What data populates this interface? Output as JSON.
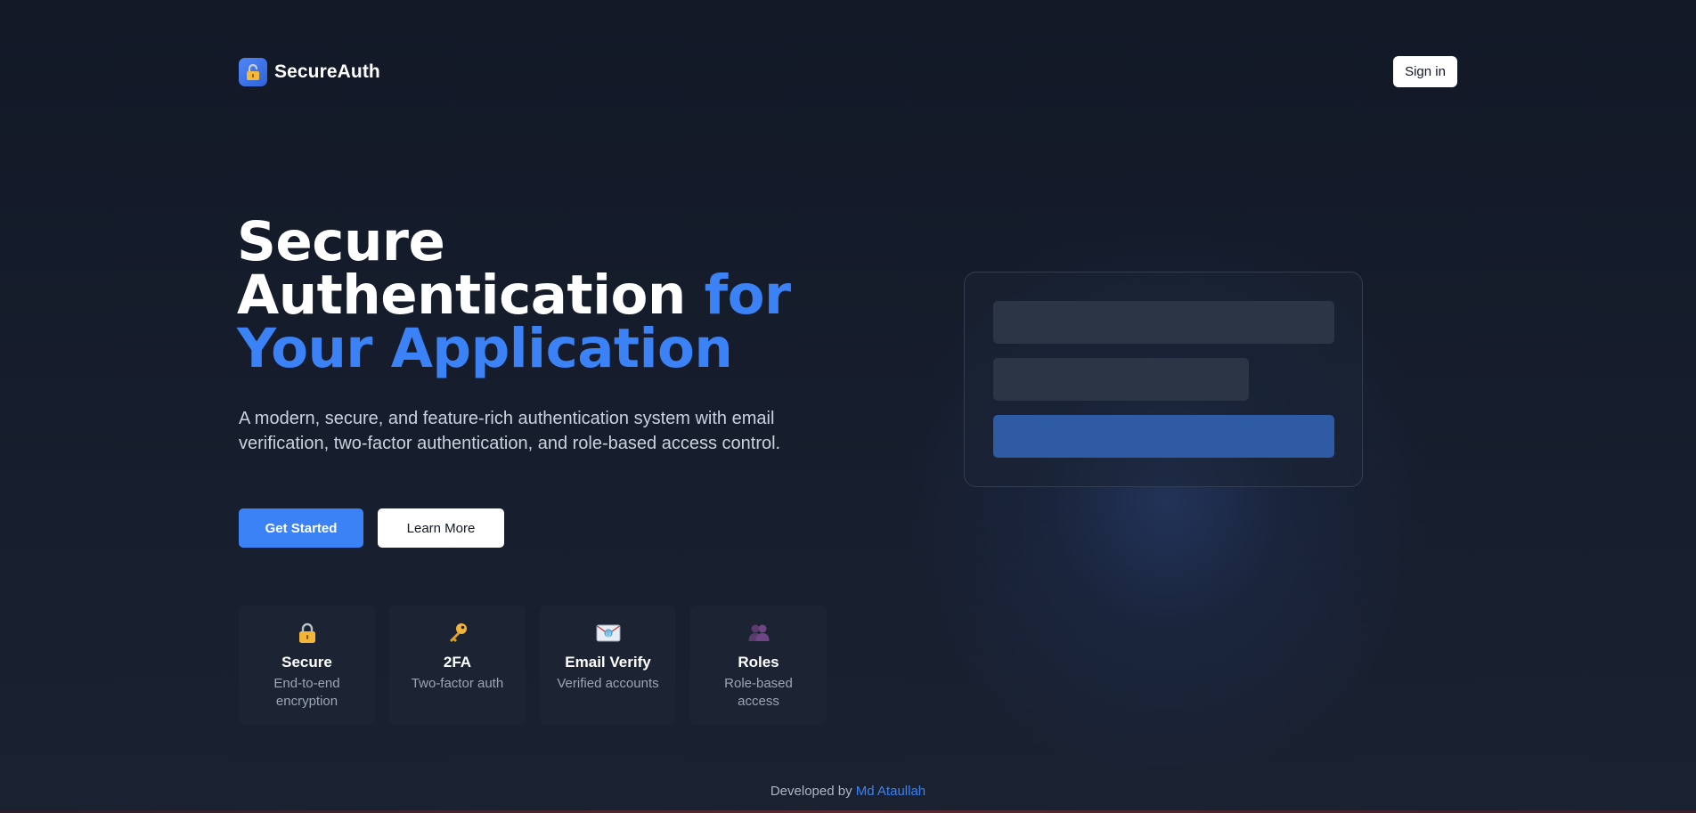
{
  "header": {
    "brand_name": "SecureAuth",
    "logo_icon": "lock-icon",
    "signin_label": "Sign in"
  },
  "hero": {
    "title_line1": "Secure",
    "title_line2_white": "Authentication",
    "title_line2_accent": "for",
    "title_line3_accent": "Your Application",
    "description": "A modern, secure, and feature-rich authentication system with email verification, two-factor authentication, and role-based access control.",
    "get_started_label": "Get Started",
    "learn_more_label": "Learn More"
  },
  "features": [
    {
      "icon": "lock-icon",
      "title": "Secure",
      "subtitle": "End-to-end encryption"
    },
    {
      "icon": "key-icon",
      "title": "2FA",
      "subtitle": "Two-factor auth"
    },
    {
      "icon": "email-icon",
      "title": "Email Verify",
      "subtitle": "Verified accounts"
    },
    {
      "icon": "users-icon",
      "title": "Roles",
      "subtitle": "Role-based access"
    }
  ],
  "footer": {
    "prefix": "Developed by",
    "author": "Md Ataullah"
  },
  "colors": {
    "accent": "#3b82f6",
    "background": "#141b29",
    "card": "#1c2433",
    "mock_field": "#2c3545",
    "mock_button": "#2f5ba4"
  }
}
